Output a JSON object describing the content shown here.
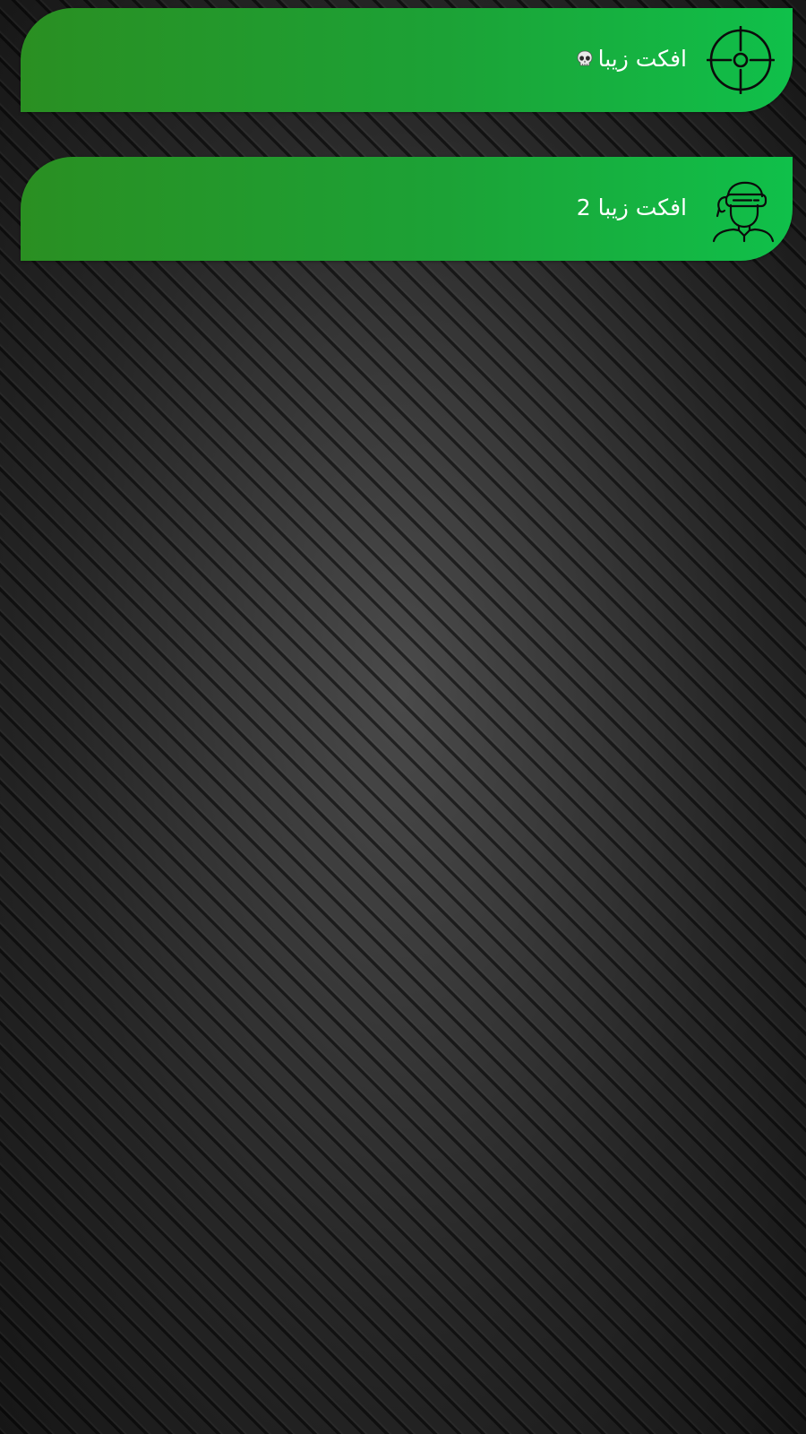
{
  "items": [
    {
      "title": "افکت زیبا",
      "icon": "crosshair-icon",
      "badge_icon": "skull-icon"
    },
    {
      "title": "افکت زیبا 2",
      "icon": "vr-headset-person-icon"
    }
  ],
  "colors": {
    "card_gradient_start": "#2a8f22",
    "card_gradient_end": "#10c04a",
    "text": "#ffffff",
    "background": "#2e2e2e"
  }
}
